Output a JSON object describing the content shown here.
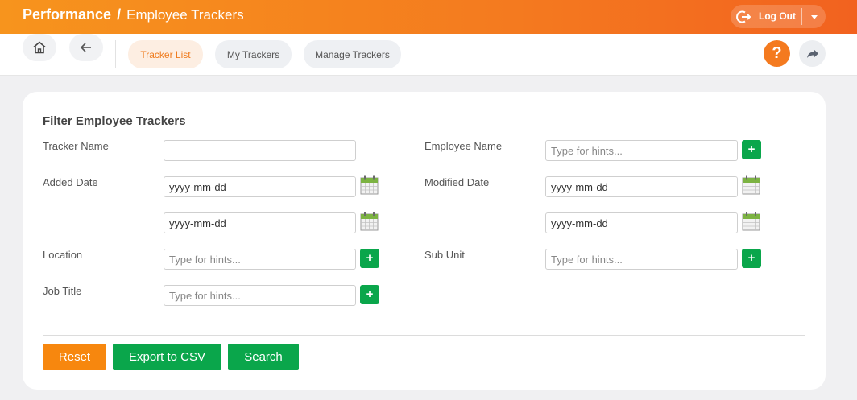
{
  "header": {
    "module": "Performance",
    "separator": "/",
    "page": "Employee Trackers",
    "logout_label": "Log Out"
  },
  "toolbar": {
    "tabs": [
      {
        "label": "Tracker List",
        "active": true
      },
      {
        "label": "My Trackers",
        "active": false
      },
      {
        "label": "Manage Trackers",
        "active": false
      }
    ],
    "help_label": "?"
  },
  "filter": {
    "title": "Filter Employee Trackers",
    "tracker_name": {
      "label": "Tracker Name",
      "value": ""
    },
    "employee_name": {
      "label": "Employee Name",
      "placeholder": "Type for hints..."
    },
    "added_date": {
      "label": "Added Date",
      "from": "yyyy-mm-dd",
      "to": "yyyy-mm-dd"
    },
    "modified_date": {
      "label": "Modified Date",
      "from": "yyyy-mm-dd",
      "to": "yyyy-mm-dd"
    },
    "location": {
      "label": "Location",
      "placeholder": "Type for hints..."
    },
    "sub_unit": {
      "label": "Sub Unit",
      "placeholder": "Type for hints..."
    },
    "job_title": {
      "label": "Job Title",
      "placeholder": "Type for hints..."
    },
    "add_label": "+"
  },
  "actions": {
    "reset": "Reset",
    "export": "Export to CSV",
    "search": "Search"
  },
  "colors": {
    "brand_orange": "#f47a1f",
    "green": "#0aa64b",
    "reset_orange": "#f7870e"
  }
}
